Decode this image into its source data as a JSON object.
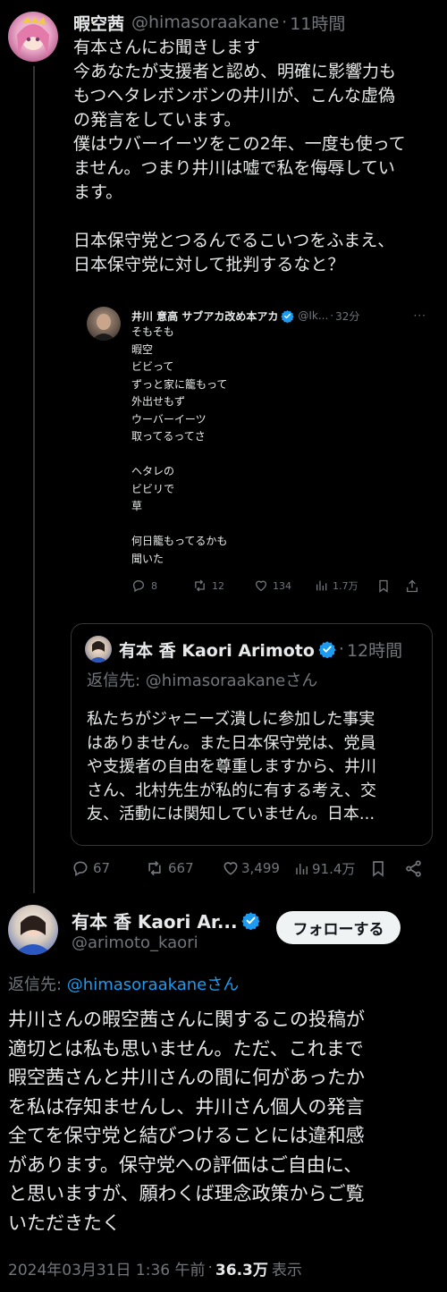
{
  "main_tweet": {
    "display_name": "暇空茜",
    "handle": "@himasoraakane",
    "separator": "·",
    "time": "11時間",
    "body": "有本さんにお聞きします\n今あなたが支援者と認め、明確に影響力も\nもつヘタレボンボンの井川が、こんな虚偽\nの発言をしています。\n僕はウバーイーツをこの2年、一度も使って\nません。つまり井川は嘘で私を侮辱してい\nます。\n\n日本保守党とつるんでるこいつをふまえ、\n日本保守党に対して批判するなと？"
  },
  "quoted_tweet": {
    "display_name": "井川 意高 サブアカ改め本アカ",
    "handle": "@Ik...",
    "separator": "·",
    "time": "32分",
    "body": "そもそも\n暇空\nビビって\nずっと家に籠もって\n外出せもず\nウーバーイーツ\n取ってるってさ\n\nヘタレの\nビビリで\n草\n\n何日籠もってるかも\n聞いた",
    "replies": "8",
    "retweets": "12",
    "likes": "134",
    "views": "1.7万"
  },
  "quoted_reply": {
    "display_name": "有本 香 Kaori Arimoto",
    "separator": "·",
    "time": "12時間",
    "reply_to_prefix": "返信先: ",
    "reply_to_handle": "@himasoraakaneさん",
    "body": "私たちがジャニーズ潰しに参加した事実\nはありません。また日本保守党は、党員\nや支援者の自由を尊重しますから、井川\nさん、北村先生が私的に有する考え、交\n友、活動には関知していません。日本..."
  },
  "main_actions": {
    "replies": "67",
    "retweets": "667",
    "likes": "3,499",
    "views": "91.4万"
  },
  "reply_tweet": {
    "display_name": "有本 香 Kaori Ar...",
    "handle": "@arimoto_kaori",
    "follow_label": "フォローする",
    "reply_to_prefix": "返信先: ",
    "reply_to_handle": "@himasoraakaneさん",
    "body": "井川さんの暇空茜さんに関するこの投稿が\n適切とは私も思いません。ただ、これまで\n暇空茜さんと井川さんの間に何があったか\nを私は存知ませんし、井川さん個人の発言\n全てを保守党と結びつけることには違和感\nがあります。保守党への評価はご自由に、\nと思いますが、願わくば理念政策からご覧\nいただきたく",
    "timestamp": "2024年03月31日 1:36 午前",
    "separator": "·",
    "views_count": "36.3万",
    "views_label": "表示"
  },
  "colors": {
    "background": "#000000",
    "text": "#e7e9ea",
    "muted": "#71767b",
    "link": "#1d9bf0",
    "border": "#333639",
    "verified": "#1d9bf0"
  },
  "icons": [
    "reply-icon",
    "retweet-icon",
    "like-icon",
    "views-icon",
    "bookmark-icon",
    "share-icon",
    "verified-icon"
  ]
}
